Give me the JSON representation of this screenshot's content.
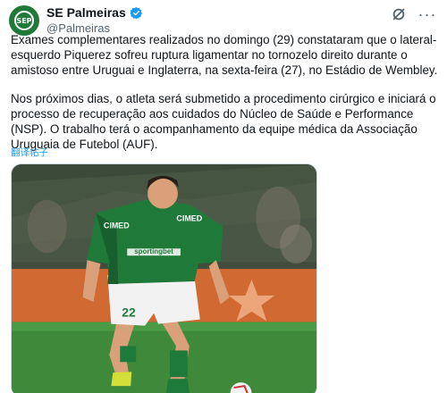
{
  "author": {
    "display_name": "SE Palmeiras",
    "handle": "@Palmeiras",
    "avatar_text": "SEP"
  },
  "tweet": {
    "paragraphs": [
      "Exames complementares realizados no domingo (29) constataram que o lateral-esquerdo Piquerez sofreu ruptura ligamentar no tornozelo direito durante o amistoso entre Uruguai e Inglaterra, na sexta-feira (27), no Estádio de Wembley.",
      "Nos próximos dias, o atleta será submetido a procedimento cirúrgico e iniciará o processo de recuperação aos cuidados do Núcleo de Saúde e Performance (NSP). O trabalho terá o acompanhamento da equipe médica da Associação Uruguaia de Futebol (AUF)."
    ],
    "translate_label": "翻译帖子"
  },
  "media": {
    "jersey_number": "22",
    "sponsors": [
      "CIMED",
      "CIMED",
      "sportingbet"
    ]
  },
  "icons": {
    "verified": "verified-badge-icon",
    "grok": "grok-icon",
    "more": "more-options-icon"
  },
  "colors": {
    "accent": "#1d9bf0",
    "palmeiras_green": "#1f7a3a"
  }
}
